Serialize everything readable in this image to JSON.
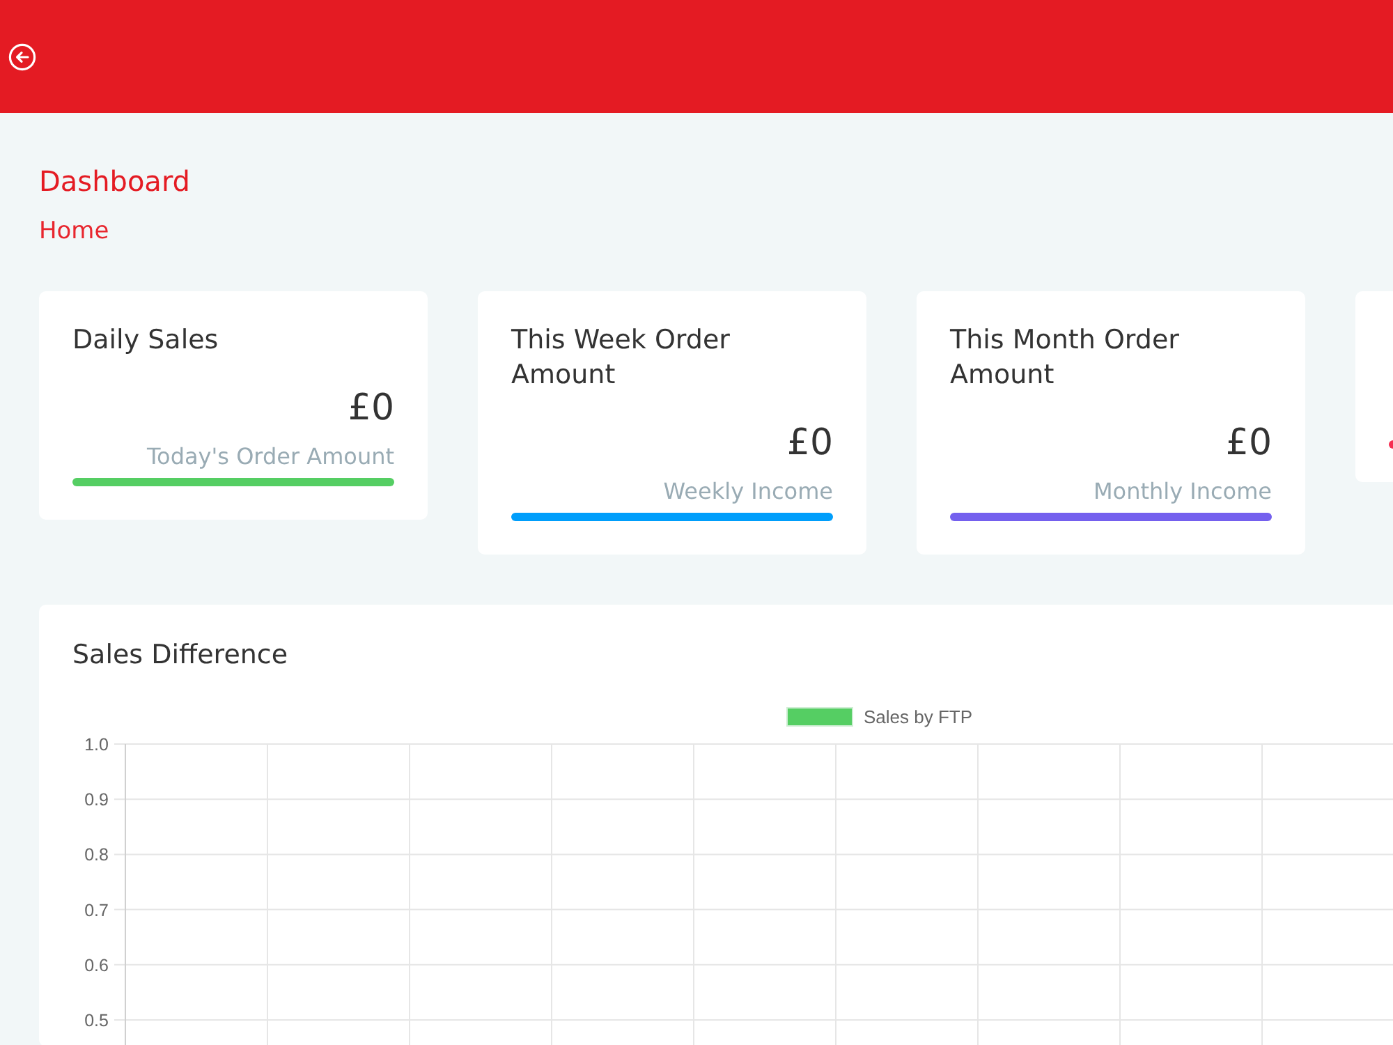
{
  "page": {
    "title": "Dashboard",
    "breadcrumb": "Home"
  },
  "stat_cards": [
    {
      "title": "Daily Sales",
      "value": "£0",
      "caption": "Today's Order Amount",
      "color": "#55ce63"
    },
    {
      "title": "This Week Order Amount",
      "value": "£0",
      "caption": "Weekly Income",
      "color": "#009efb"
    },
    {
      "title": "This Month Order Amount",
      "value": "£0",
      "caption": "Monthly Income",
      "color": "#7460ee"
    },
    {
      "color": "#f62d51"
    }
  ],
  "chart_card": {
    "title": "Sales Difference",
    "chart_data": {
      "type": "bar",
      "series": [
        {
          "name": "Sales by FTP",
          "color": "#55ce63"
        }
      ],
      "ylim": [
        0,
        1
      ],
      "yticks": [
        0.5,
        0.6,
        0.7,
        0.8,
        0.9,
        {
          "value": 1,
          "label": "1.0"
        }
      ],
      "grid": true
    }
  }
}
